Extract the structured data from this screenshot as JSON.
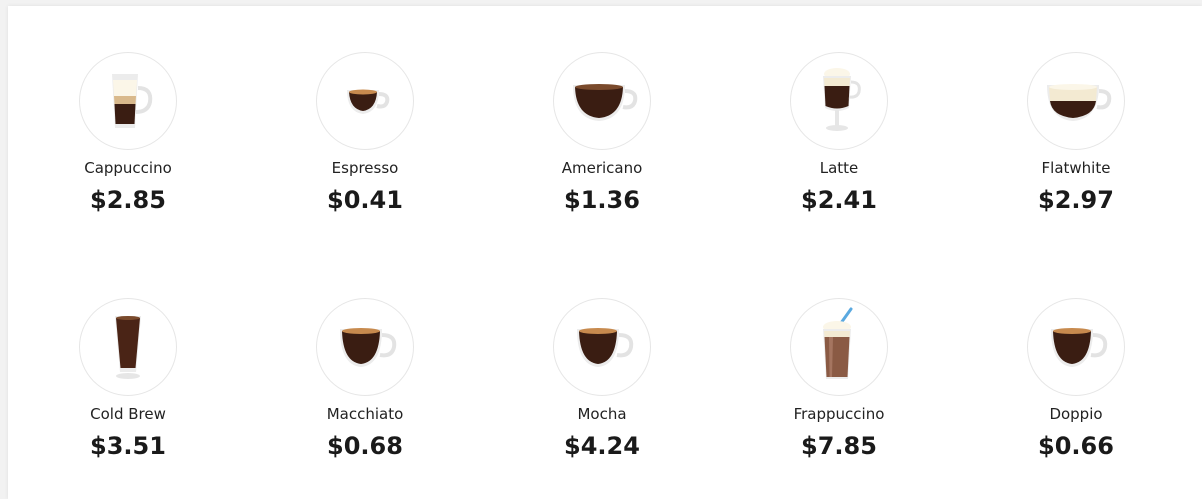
{
  "menu": {
    "items": [
      {
        "name": "Cappuccino",
        "price": "$2.85",
        "icon": "cappuccino-glass-icon"
      },
      {
        "name": "Espresso",
        "price": "$0.41",
        "icon": "espresso-cup-icon"
      },
      {
        "name": "Americano",
        "price": "$1.36",
        "icon": "americano-cup-icon"
      },
      {
        "name": "Latte",
        "price": "$2.41",
        "icon": "latte-glass-icon"
      },
      {
        "name": "Flatwhite",
        "price": "$2.97",
        "icon": "flatwhite-cup-icon"
      },
      {
        "name": "Cold Brew",
        "price": "$3.51",
        "icon": "cold-brew-glass-icon"
      },
      {
        "name": "Macchiato",
        "price": "$0.68",
        "icon": "macchiato-cup-icon"
      },
      {
        "name": "Mocha",
        "price": "$4.24",
        "icon": "mocha-cup-icon"
      },
      {
        "name": "Frappuccino",
        "price": "$7.85",
        "icon": "frappuccino-glass-icon"
      },
      {
        "name": "Doppio",
        "price": "$0.66",
        "icon": "doppio-cup-icon"
      }
    ]
  },
  "colors": {
    "coffee_dark": "#3a1d12",
    "coffee_mid": "#5a2f1c",
    "crema": "#c78a4e",
    "milk": "#f3ead2",
    "foam": "#fbf6e8",
    "glass": "#e9e9e9"
  }
}
